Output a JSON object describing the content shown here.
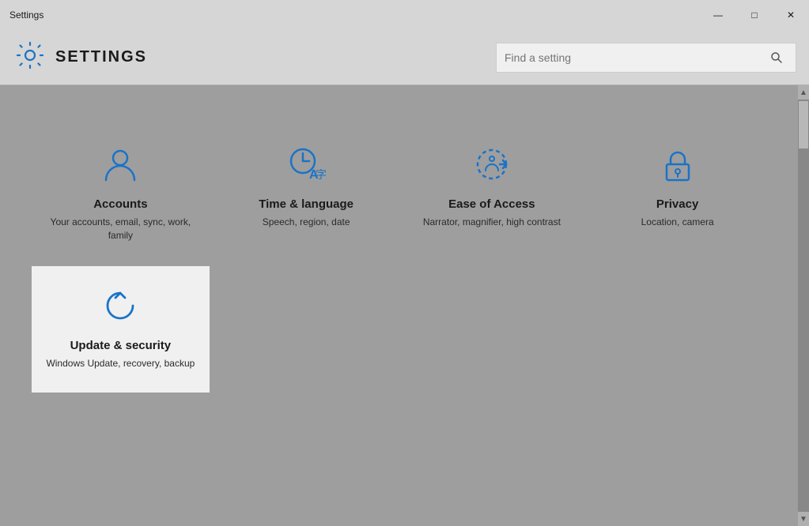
{
  "titleBar": {
    "title": "Settings",
    "minBtn": "—",
    "maxBtn": "□",
    "closeBtn": "✕"
  },
  "header": {
    "appTitle": "SETTINGS",
    "search": {
      "placeholder": "Find a setting"
    }
  },
  "tiles": [
    {
      "id": "accounts",
      "name": "Accounts",
      "desc": "Your accounts, email, sync, work, family",
      "selected": false
    },
    {
      "id": "time-language",
      "name": "Time & language",
      "desc": "Speech, region, date",
      "selected": false
    },
    {
      "id": "ease-of-access",
      "name": "Ease of Access",
      "desc": "Narrator, magnifier, high contrast",
      "selected": false
    },
    {
      "id": "privacy",
      "name": "Privacy",
      "desc": "Location, camera",
      "selected": false
    },
    {
      "id": "update-security",
      "name": "Update & security",
      "desc": "Windows Update, recovery, backup",
      "selected": true
    }
  ],
  "colors": {
    "iconBlue": "#1a73c8",
    "titleBg": "#d6d6d6",
    "mainBg": "#9e9e9e",
    "selectedTile": "#f0f0f0"
  }
}
